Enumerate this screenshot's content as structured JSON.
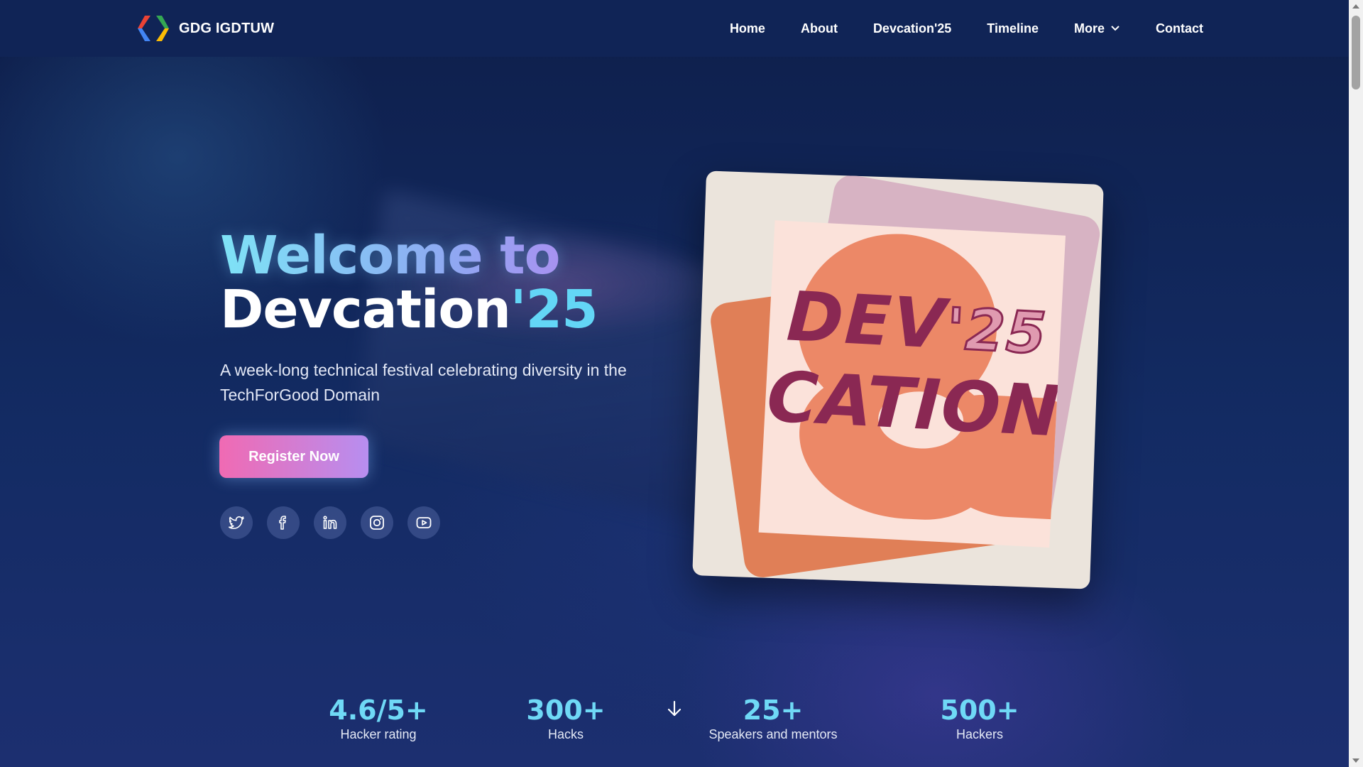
{
  "brand": {
    "name": "GDG IGDTUW",
    "logo_icon": "gdg-logo-icon"
  },
  "nav": {
    "items": [
      {
        "label": "Home"
      },
      {
        "label": "About"
      },
      {
        "label": "Devcation'25"
      },
      {
        "label": "Timeline"
      },
      {
        "label": "More",
        "icon": "chevron-down-icon"
      },
      {
        "label": "Contact"
      }
    ]
  },
  "hero": {
    "title_line1": "Welcome to",
    "title_line2_main": "Devcation",
    "title_line2_accent": "'25",
    "subtitle": "A week-long technical festival celebrating diversity in the TechForGood Domain",
    "register_label": "Register Now",
    "socials": [
      {
        "icon": "twitter-icon"
      },
      {
        "icon": "facebook-icon"
      },
      {
        "icon": "linkedin-icon"
      },
      {
        "icon": "instagram-icon"
      },
      {
        "icon": "youtube-icon"
      }
    ],
    "poster": {
      "line1_main": "DEV",
      "line1_num": "'25",
      "line2": "CATION"
    }
  },
  "stats": [
    {
      "value": "4.6/5+",
      "label": "Hacker rating"
    },
    {
      "value": "300+",
      "label": "Hacks"
    },
    {
      "value": "25+",
      "label": "Speakers and mentors"
    },
    {
      "value": "500+",
      "label": "Hackers"
    }
  ],
  "scroll_hint_icon": "arrow-down-icon",
  "colors": {
    "nav_bg": "#102456",
    "accent_cyan": "#6fd9f6",
    "button_start": "#f06ab3",
    "button_end": "#b78ef0",
    "poster_maroon": "#8a2853"
  }
}
